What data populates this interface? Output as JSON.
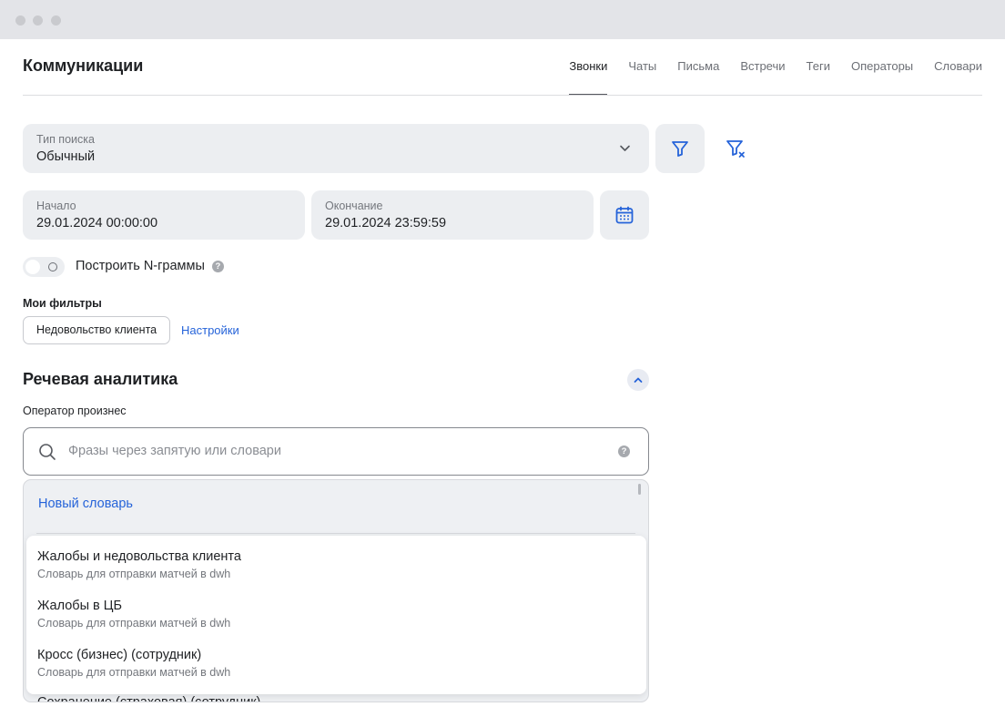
{
  "window": {
    "controls": [
      "close",
      "minimize",
      "zoom"
    ]
  },
  "header": {
    "title": "Коммуникации",
    "tabs": [
      {
        "label": "Звонки",
        "active": true
      },
      {
        "label": "Чаты",
        "active": false
      },
      {
        "label": "Письма",
        "active": false
      },
      {
        "label": "Встречи",
        "active": false
      },
      {
        "label": "Теги",
        "active": false
      },
      {
        "label": "Операторы",
        "active": false
      },
      {
        "label": "Словари",
        "active": false
      }
    ]
  },
  "search_type": {
    "label": "Тип поиска",
    "value": "Обычный"
  },
  "date_range": {
    "start": {
      "label": "Начало",
      "value": "29.01.2024 00:00:00"
    },
    "end": {
      "label": "Окончание",
      "value": "29.01.2024 23:59:59"
    }
  },
  "ngrams": {
    "label": "Построить N-граммы",
    "enabled": false,
    "help": "?"
  },
  "my_filters": {
    "title": "Мои фильтры",
    "chips": [
      "Недовольство клиента"
    ],
    "settings_link": "Настройки"
  },
  "speech_analytics": {
    "title": "Речевая аналитика",
    "operator_said": {
      "label": "Оператор произнес",
      "placeholder": "Фразы через запятую или словари",
      "help": "?"
    },
    "dropdown": {
      "new_dictionary": "Новый словарь",
      "items": [
        {
          "name": "Жалобы и недовольства клиента",
          "desc": "Словарь для отправки матчей в dwh"
        },
        {
          "name": "Жалобы в ЦБ",
          "desc": "Словарь для отправки матчей в dwh"
        },
        {
          "name": "Кросс (бизнес) (сотрудник)",
          "desc": "Словарь для отправки матчей в dwh"
        }
      ],
      "partial_item": "Сохранение (страховая) (сотрудник)"
    }
  },
  "colors": {
    "accent": "#2563d9",
    "field_bg": "#eceef1",
    "text": "#1f2124",
    "muted": "#74777d"
  },
  "icons": [
    "chevron-down-icon",
    "filter-icon",
    "filter-clear-icon",
    "calendar-icon",
    "search-icon",
    "help-icon",
    "chevron-up-icon"
  ]
}
